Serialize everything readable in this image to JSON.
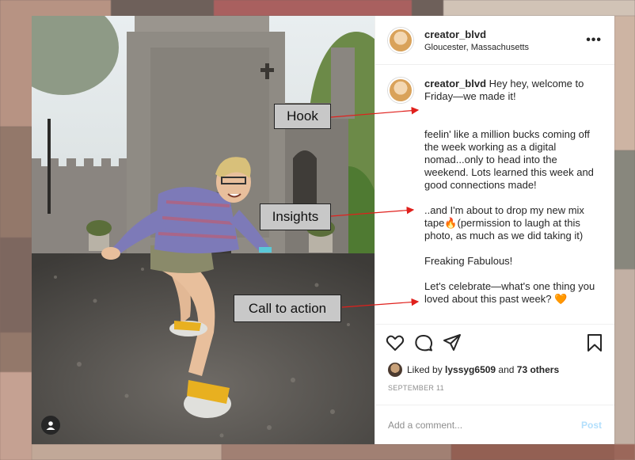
{
  "post": {
    "username": "creator_blvd",
    "location": "Gloucester, Massachusetts",
    "more_label": "•••"
  },
  "caption": {
    "username": "creator_blvd",
    "p1": " Hey hey, welcome to Friday—we made it!",
    "p2": "feelin' like a million bucks coming off the week working as a digital nomad...only to head into the weekend. Lots learned this week and good connections made!",
    "p3": "..and I'm about to drop my new mix tape🔥(permission to laugh at this photo, as much as we did taking it)",
    "p4": "Freaking Fabulous!",
    "p5": "Let's celebrate—what's one thing you loved about this past week? 🧡",
    "p6": "~..."
  },
  "likes": {
    "prefix": "Liked by ",
    "user": "lyssyg6509",
    "middle": " and ",
    "others": "73 others"
  },
  "date": "SEPTEMBER 11",
  "comment_box": {
    "placeholder": "Add a comment...",
    "post_label": "Post"
  },
  "callouts": {
    "hook": "Hook",
    "insights": "Insights",
    "cta": "Call to action"
  },
  "colors": {
    "arrow": "#e0201c",
    "post_disabled": "#b2dffc",
    "heart_emoji": "#f07a22"
  },
  "icons": [
    "heart-icon",
    "comment-icon",
    "share-icon",
    "bookmark-icon",
    "more-icon",
    "user-tag-icon"
  ]
}
